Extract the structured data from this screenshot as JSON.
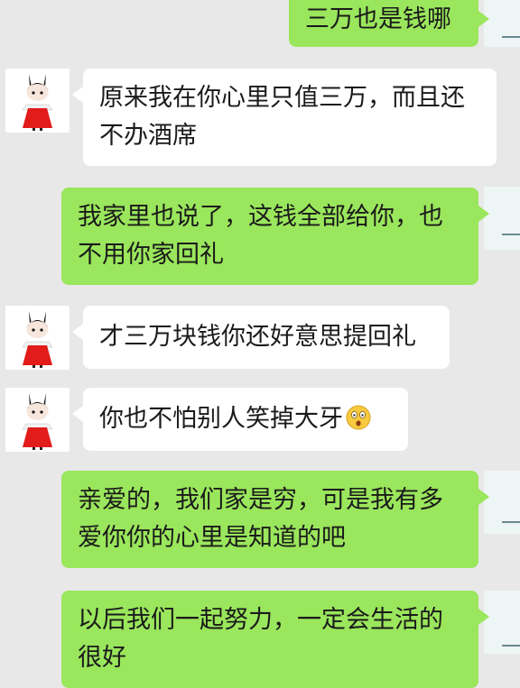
{
  "chat": {
    "messages": [
      {
        "side": "out",
        "lines": [
          "三万也是钱哪"
        ]
      },
      {
        "side": "in",
        "lines": [
          "原来我在你心里只值三万，而且还",
          "不办酒席"
        ]
      },
      {
        "side": "out",
        "lines": [
          "我家里也说了，这钱全部给你，也",
          "不用你家回礼"
        ]
      },
      {
        "side": "in",
        "lines": [
          "才三万块钱你还好意思提回礼"
        ]
      },
      {
        "side": "in",
        "lines": [
          "你也不怕别人笑掉大牙"
        ],
        "emoji": "surprised-face"
      },
      {
        "side": "out",
        "lines": [
          "亲爱的，我们家是穷，可是我有多",
          "爱你你的心里是知道的吧"
        ]
      },
      {
        "side": "out",
        "lines": [
          "以后我们一起努力，一定会生活的",
          "很好"
        ]
      }
    ]
  },
  "colors": {
    "background": "#e8e8e8",
    "incoming_bubble": "#ffffff",
    "outgoing_bubble": "#9ae65c"
  },
  "icons": {
    "contact_avatar": "cartoon-girl-red-dress-avatar-icon",
    "own_avatar": "landscape-photo-avatar-icon",
    "emoji": "surprised-face-emoji-icon"
  }
}
